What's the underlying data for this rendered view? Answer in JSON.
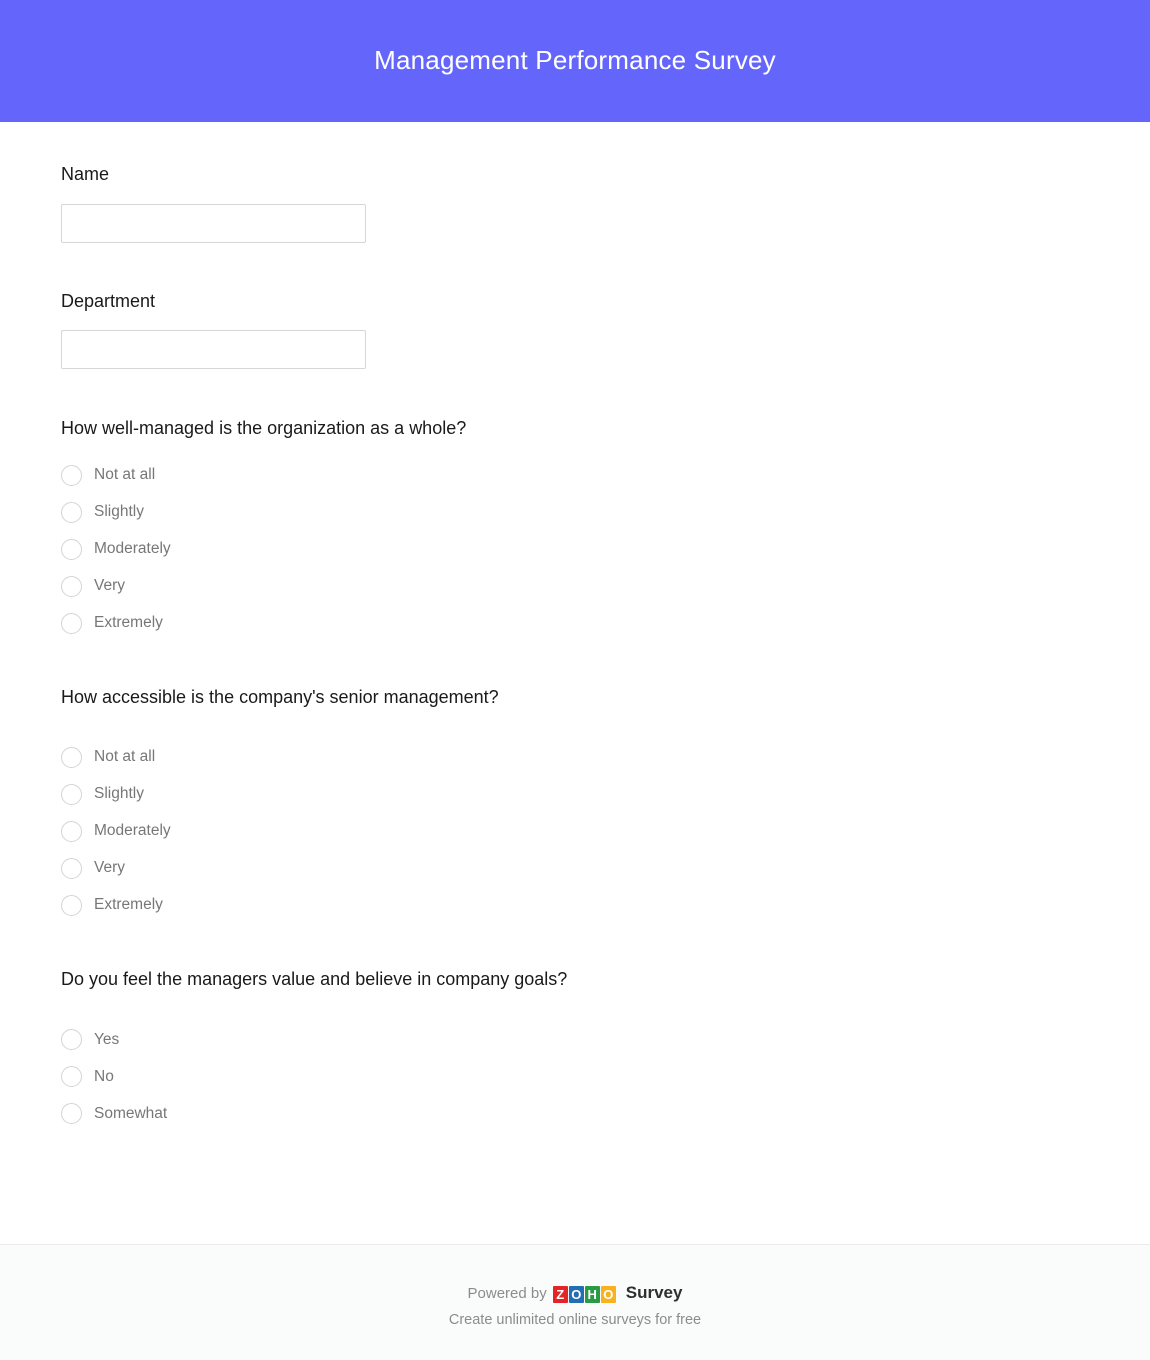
{
  "header": {
    "title": "Management Performance Survey",
    "background_color": "#6466fb",
    "text_color": "#ffffff"
  },
  "fields": [
    {
      "label": "Name",
      "value": "",
      "placeholder": ""
    },
    {
      "label": "Department",
      "value": "",
      "placeholder": ""
    }
  ],
  "questions": [
    {
      "text": "How well-managed is the organization as a whole?",
      "options": [
        "Not at all",
        "Slightly",
        "Moderately",
        "Very",
        "Extremely"
      ]
    },
    {
      "text": "How accessible is the company's senior management?",
      "options": [
        "Not at all",
        "Slightly",
        "Moderately",
        "Very",
        "Extremely"
      ]
    },
    {
      "text": "Do you feel the managers value and believe in company goals?",
      "options": [
        "Yes",
        "No",
        "Somewhat"
      ]
    }
  ],
  "footer": {
    "powered_by": "Powered by",
    "logo_letters": [
      "Z",
      "O",
      "H",
      "O"
    ],
    "logo_colors": [
      "#e42527",
      "#226db4",
      "#299b46",
      "#f9b21d"
    ],
    "product_name": "Survey",
    "tagline": "Create unlimited online surveys for free"
  }
}
